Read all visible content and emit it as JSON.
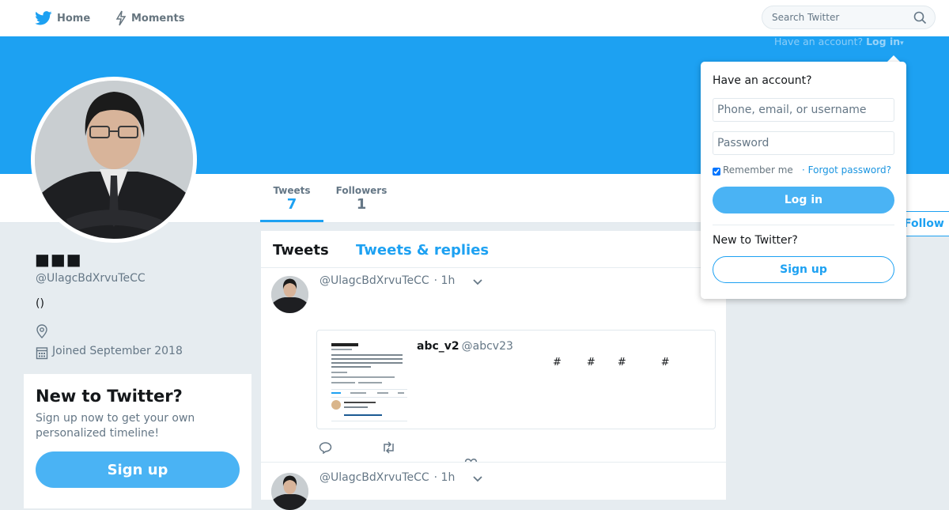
{
  "nav": {
    "home_label": "Home",
    "moments_label": "Moments",
    "search_placeholder": "Search Twitter"
  },
  "header": {
    "have_account": "Have an account?",
    "login_label": "Log in"
  },
  "profile": {
    "name": "■■■",
    "handle": "@UlagcBdXrvuTeCC",
    "bio": "()",
    "joined": "Joined September 2018",
    "stats": {
      "tweets_label": "Tweets",
      "tweets_value": "7",
      "followers_label": "Followers",
      "followers_value": "1"
    },
    "follow_label": "Follow"
  },
  "new_to_twitter": {
    "title": "New to Twitter?",
    "text": "Sign up now to get your own personalized timeline!",
    "signup_label": "Sign up"
  },
  "timeline": {
    "tabs": [
      "Tweets",
      "Tweets & replies"
    ],
    "tweets": [
      {
        "handle": "@UlagcBdXrvuTeCC",
        "time": "1h",
        "card": {
          "name": "abc_v2",
          "handle": "@abcv23",
          "desc": [
            "#",
            "#",
            "#",
            "#"
          ]
        }
      },
      {
        "handle": "@UlagcBdXrvuTeCC",
        "time": "1h"
      }
    ]
  },
  "login_dropdown": {
    "title": "Have an account?",
    "username_placeholder": "Phone, email, or username",
    "password_placeholder": "Password",
    "remember_label": "Remember me",
    "forgot_label": "· Forgot password?",
    "login_button": "Log in",
    "new_title": "New to Twitter?",
    "signup_button": "Sign up"
  },
  "colors": {
    "brand": "#1da1f2",
    "button": "#4ab3f4",
    "background": "#e6ecf0"
  }
}
